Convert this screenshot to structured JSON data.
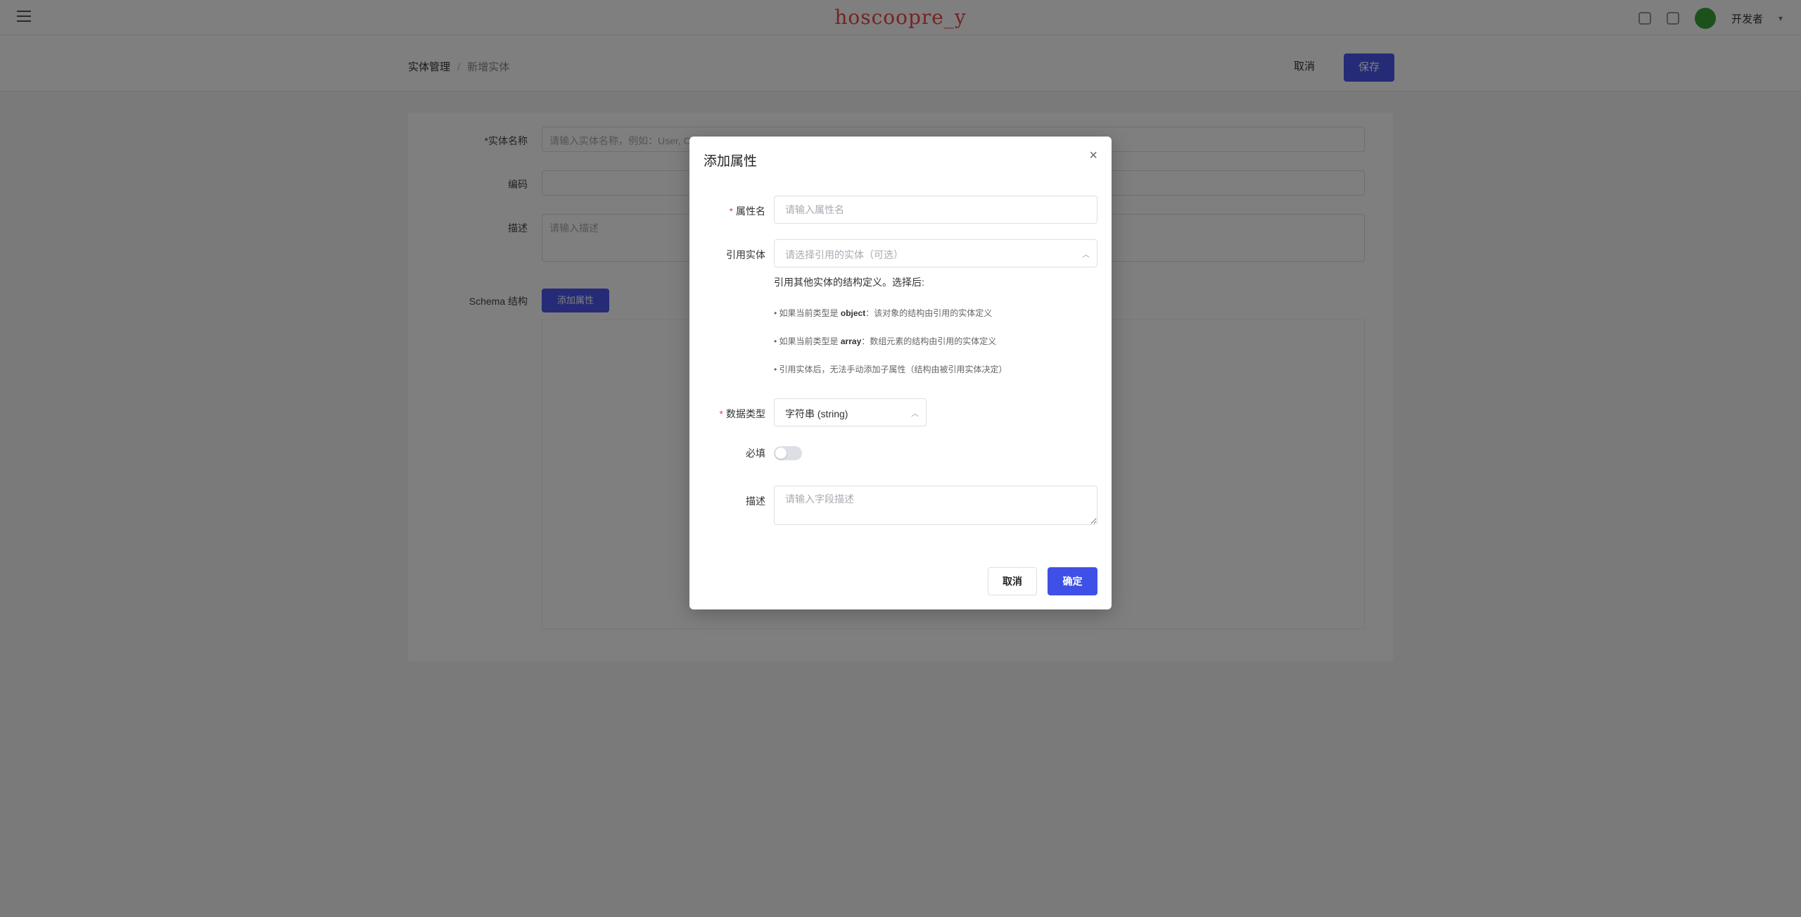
{
  "background": {
    "brand": "hoscoopre_y",
    "username": "开发者",
    "breadcrumb": [
      "实体管理",
      "新增实体"
    ],
    "header_buttons": {
      "back": "取消",
      "save": "保存"
    },
    "form": {
      "name_label": "*实体名称",
      "name_placeholder": "请输入实体名称，例如：User, Order",
      "code_label": "编码",
      "code_value": "",
      "desc_label": "描述",
      "desc_placeholder": "请输入描述",
      "schema_label": "Schema 结构",
      "add_button": "添加属性"
    }
  },
  "modal": {
    "title": "添加属性",
    "close": "×",
    "fields": {
      "name": {
        "label": "属性名",
        "placeholder": "请输入属性名",
        "required": true
      },
      "ref_entity": {
        "label": "引用实体",
        "placeholder": "请选择引用的实体（可选）"
      },
      "data_type": {
        "label": "数据类型",
        "value": "字符串 (string)",
        "required": true
      },
      "required": {
        "label": "必填",
        "value": false
      },
      "description": {
        "label": "描述",
        "placeholder": "请输入字段描述"
      }
    },
    "help": {
      "intro": "引用其他实体的结构定义。选择后:",
      "bullets": [
        {
          "prefix": "• 如果当前类型是 ",
          "keyword": "object",
          "suffix": "：该对象的结构由引用的实体定义"
        },
        {
          "prefix": "• 如果当前类型是 ",
          "keyword": "array",
          "suffix": "：数组元素的结构由引用的实体定义"
        },
        {
          "prefix": "• 引用实体后，无法手动添加子属性（结构由被引用实体决定）",
          "keyword": "",
          "suffix": ""
        }
      ]
    },
    "buttons": {
      "cancel": "取消",
      "confirm": "确定"
    }
  },
  "colors": {
    "primary": "#3f50e6",
    "required_star": "#e5484d",
    "overlay": "rgba(0,0,0,0.5)"
  }
}
